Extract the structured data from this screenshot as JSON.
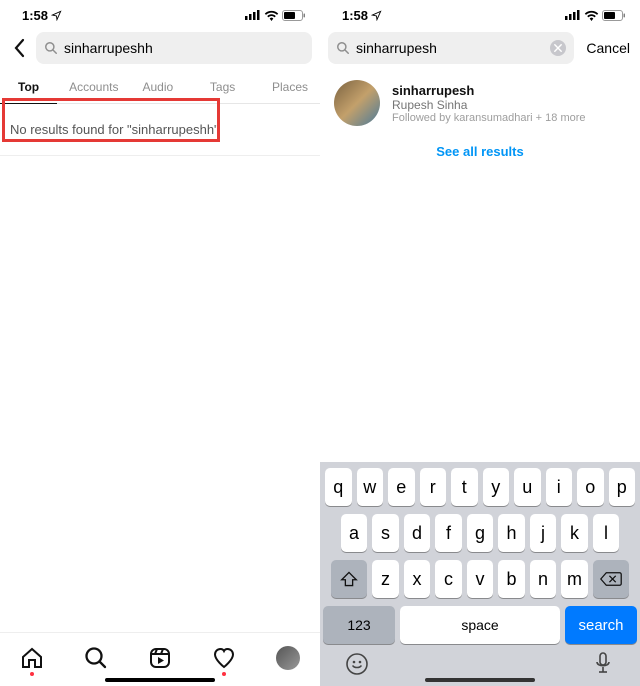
{
  "status": {
    "time": "1:58",
    "signal": true,
    "wifi": true,
    "battery": true
  },
  "left": {
    "search_value": "sinharrupeshh",
    "tabs": [
      "Top",
      "Accounts",
      "Audio",
      "Tags",
      "Places"
    ],
    "active_tab": "Top",
    "no_results_text": "No results found for \"sinharrupeshh\""
  },
  "right": {
    "search_value": "sinharrupesh",
    "cancel_label": "Cancel",
    "result": {
      "username": "sinharrupesh",
      "name": "Rupesh Sinha",
      "followed_by": "Followed by karansumadhari + 18 more"
    },
    "see_all_label": "See all results",
    "keyboard": {
      "row1": [
        "q",
        "w",
        "e",
        "r",
        "t",
        "y",
        "u",
        "i",
        "o",
        "p"
      ],
      "row2": [
        "a",
        "s",
        "d",
        "f",
        "g",
        "h",
        "j",
        "k",
        "l"
      ],
      "row3": [
        "z",
        "x",
        "c",
        "v",
        "b",
        "n",
        "m"
      ],
      "num_label": "123",
      "space_label": "space",
      "search_label": "search"
    }
  }
}
